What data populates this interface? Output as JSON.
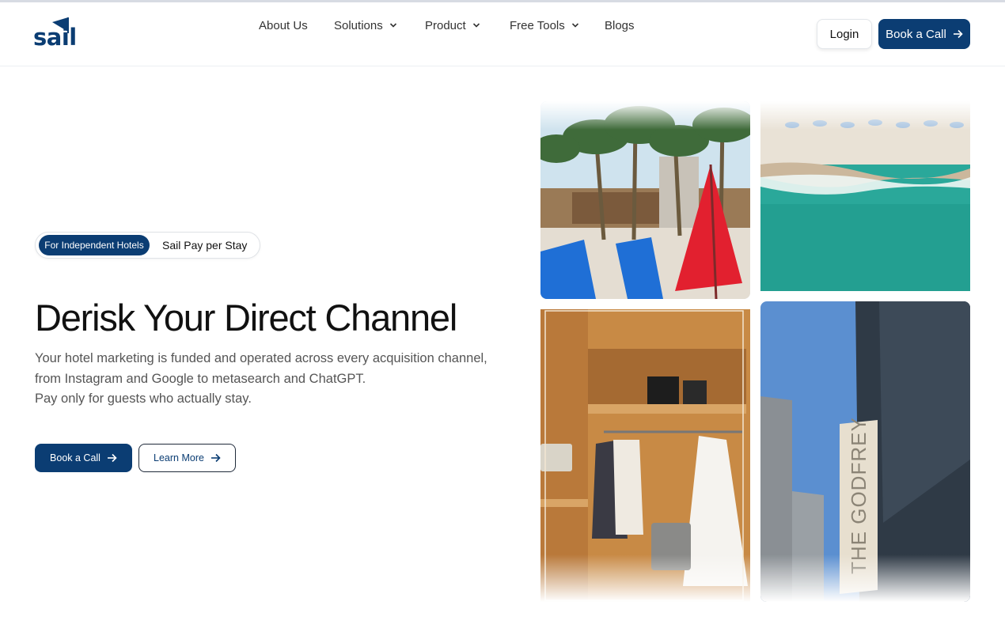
{
  "brand": {
    "name": "sail"
  },
  "nav": {
    "about": "About Us",
    "solutions": "Solutions",
    "product": "Product",
    "free_tools": "Free Tools",
    "blogs": "Blogs"
  },
  "header_actions": {
    "login": "Login",
    "book_call": "Book a Call"
  },
  "hero": {
    "badge": "For Independent Hotels",
    "badge_text": "Sail Pay per Stay",
    "title": "Derisk Your Direct Channel",
    "description_lines": [
      "Your hotel marketing is funded and operated across every acquisition channel,",
      "from Instagram and Google to metasearch and ChatGPT.",
      "Pay only for guests who actually stay."
    ],
    "primary_cta": "Book a Call",
    "secondary_cta": "Learn More"
  },
  "images": {
    "building_sign": "THE GODFREY"
  },
  "colors": {
    "primary": "#0b3d73",
    "accent_red": "#e2202f",
    "sea": "#2aa89a"
  }
}
